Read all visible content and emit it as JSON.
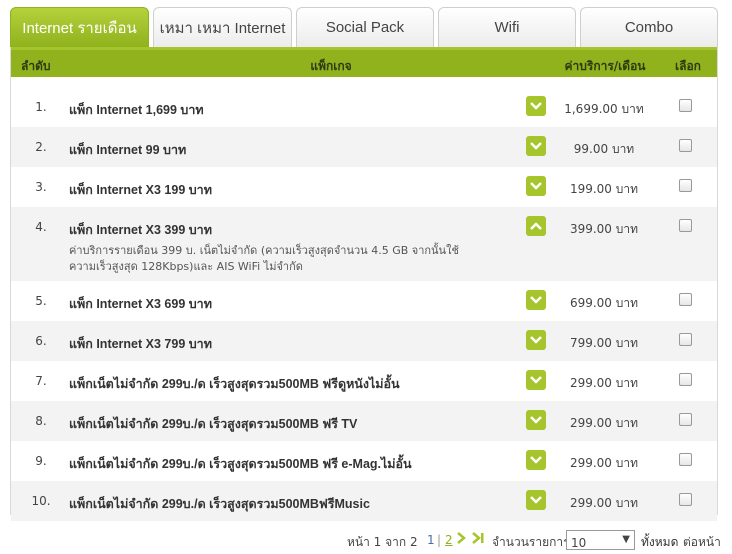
{
  "tabs": [
    {
      "label": "Internet รายเดือน",
      "active": true
    },
    {
      "label": "เหมา เหมา Internet",
      "active": false
    },
    {
      "label": "Social Pack",
      "active": false
    },
    {
      "label": "Wifi",
      "active": false
    },
    {
      "label": "Combo",
      "active": false
    }
  ],
  "table": {
    "headers": {
      "num": "ลำดับ",
      "package": "แพ็กเกจ",
      "price": "ค่าบริการ/เดือน",
      "select": "เลือก"
    },
    "rows": [
      {
        "num": "1.",
        "name": "แพ็ก Internet 1,699 บาท",
        "price": "1,699.00 บาท",
        "expanded": false
      },
      {
        "num": "2.",
        "name": "แพ็ก Internet 99 บาท",
        "price": "99.00 บาท",
        "expanded": false
      },
      {
        "num": "3.",
        "name": "แพ็ก Internet X3 199 บาท",
        "price": "199.00 บาท",
        "expanded": false
      },
      {
        "num": "4.",
        "name": "แพ็ก Internet X3 399 บาท",
        "price": "399.00 บาท",
        "expanded": true,
        "description": "ค่าบริการรายเดือน 399 บ. เน็ตไม่จำกัด (ความเร็วสูงสุดจำนวน 4.5 GB จากนั้นใช้ความเร็วสูงสุด 128Kbps)และ AIS WiFi ไม่จำกัด"
      },
      {
        "num": "5.",
        "name": "แพ็ก Internet X3 699 บาท",
        "price": "699.00 บาท",
        "expanded": false
      },
      {
        "num": "6.",
        "name": "แพ็ก Internet X3 799 บาท",
        "price": "799.00 บาท",
        "expanded": false
      },
      {
        "num": "7.",
        "name": "แพ็กเน็ตไม่จำกัด 299บ./ด เร็วสูงสุดรวม500MB ฟรีดูหนังไม่อั้น",
        "price": "299.00 บาท",
        "expanded": false
      },
      {
        "num": "8.",
        "name": "แพ็กเน็ตไม่จำกัด 299บ./ด เร็วสูงสุดรวม500MB ฟรี TV",
        "price": "299.00 บาท",
        "expanded": false
      },
      {
        "num": "9.",
        "name": "แพ็กเน็ตไม่จำกัด 299บ./ด เร็วสูงสุดรวม500MB ฟรี e-Mag.ไม่อั้น",
        "price": "299.00 บาท",
        "expanded": false
      },
      {
        "num": "10.",
        "name": "แพ็กเน็ตไม่จำกัด 299บ./ด เร็วสูงสุดรวม500MBฟรีMusic",
        "price": "299.00 บาท",
        "expanded": false
      }
    ]
  },
  "pager": {
    "page_info": "หน้า 1 จาก 2",
    "page1": "1",
    "sep": "|",
    "page2": "2",
    "per_page_label": "จำนวนรายการ",
    "per_page_value": "10",
    "show_all": "ทั้งหมด",
    "per_page_suffix": "ต่อหน้า"
  },
  "colors": {
    "accent": "#8fb21d",
    "toggle": "#a6c52d"
  }
}
